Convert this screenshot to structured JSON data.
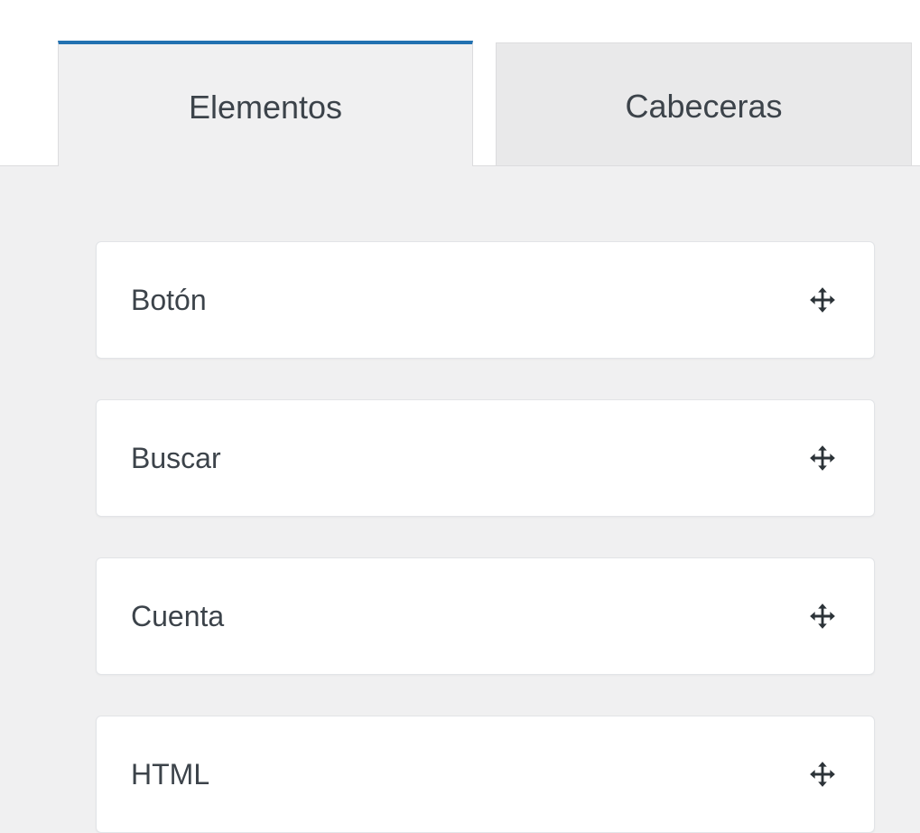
{
  "tabs": [
    {
      "label": "Elementos",
      "active": true
    },
    {
      "label": "Cabeceras",
      "active": false
    }
  ],
  "elements": [
    {
      "label": "Botón",
      "icon": "move-icon"
    },
    {
      "label": "Buscar",
      "icon": "move-icon"
    },
    {
      "label": "Cuenta",
      "icon": "move-icon"
    },
    {
      "label": "HTML",
      "icon": "move-icon"
    }
  ],
  "colors": {
    "accent": "#2271b1",
    "panel_bg": "#f0f0f1",
    "inactive_tab_bg": "#e9e9ea",
    "text": "#3c434a",
    "icon": "#2c3338"
  }
}
